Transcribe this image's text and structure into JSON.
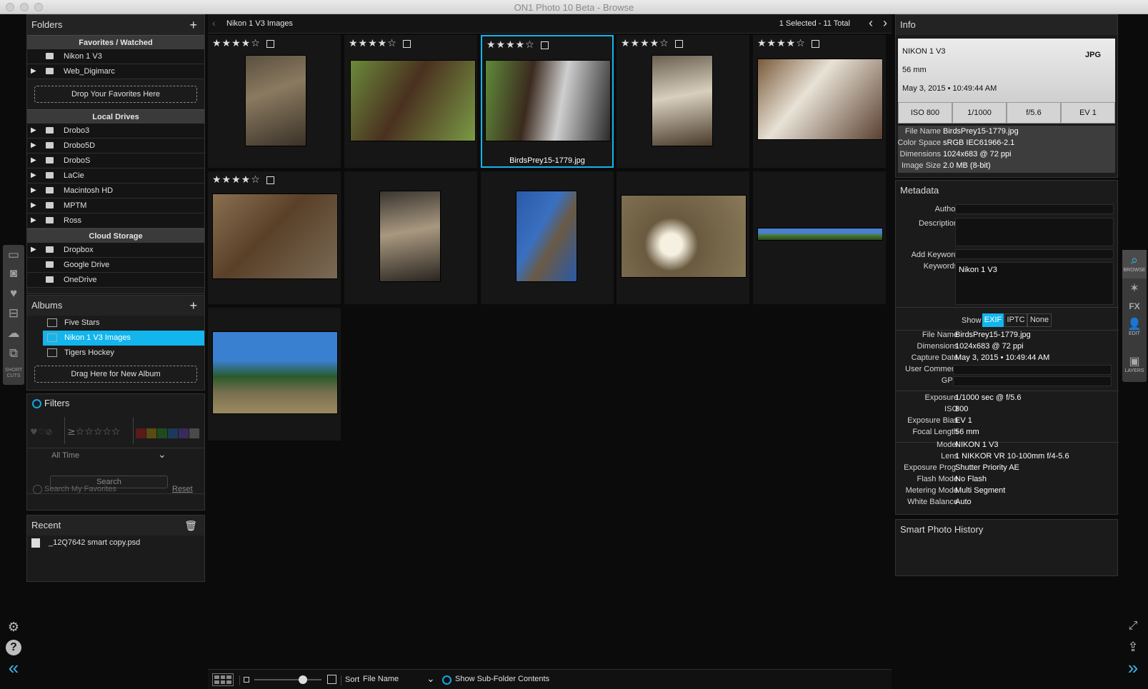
{
  "window": {
    "title": "ON1 Photo 10 Beta - Browse"
  },
  "folders": {
    "title": "Folders",
    "favorites_header": "Favorites / Watched",
    "favorites": [
      "Nikon 1 V3",
      "Web_Digimarc"
    ],
    "drop_favorites": "Drop Your Favorites Here",
    "local_header": "Local Drives",
    "local": [
      "Drobo3",
      "Drobo5D",
      "DroboS",
      "LaCie",
      "Macintosh HD",
      "MPTM",
      "Ross"
    ],
    "cloud_header": "Cloud Storage",
    "cloud": [
      "Dropbox",
      "Google Drive",
      "OneDrive"
    ]
  },
  "albums": {
    "title": "Albums",
    "items": [
      "Five Stars",
      "Nikon 1 V3 Images",
      "Tigers Hockey"
    ],
    "selected_index": 1,
    "drop": "Drag Here for New Album"
  },
  "filters": {
    "title": "Filters",
    "time": "All Time",
    "search_placeholder": "Search",
    "search_favorites": "Search My Favorites",
    "reset": "Reset",
    "swatch_colors": [
      "#5a1a1a",
      "#5a4a14",
      "#1f4a1f",
      "#1b3a5a",
      "#3a2a5a",
      "#4a4a4a"
    ]
  },
  "recent": {
    "title": "Recent",
    "items": [
      "_12Q7642 smart copy.psd"
    ]
  },
  "left_rail": {
    "shortcuts_label": "SHORT CUTS"
  },
  "grid": {
    "path": "Nikon 1 V3 Images",
    "count": "1 Selected - 11 Total",
    "selected_name": "BirdsPrey15-1779.jpg",
    "rating": 4,
    "sort_label": "Sort",
    "sort_value": "File Name",
    "subfolder": "Show Sub-Folder Contents",
    "thumb_size": 0.72
  },
  "info": {
    "title": "Info",
    "camera": "NIKON 1 V3",
    "focal": "56 mm",
    "date": "May 3, 2015 • 10:49:44 AM",
    "format": "JPG",
    "iso": "ISO 800",
    "shutter": "1/1000",
    "aperture": "f/5.6",
    "ev": "EV 1",
    "file_name_k": "File Name",
    "file_name_v": "BirdsPrey15-1779.jpg",
    "color_space_k": "Color Space",
    "color_space_v": "sRGB IEC61966-2.1",
    "dimensions_k": "Dimensions",
    "dimensions_v": "1024x683 @ 72 ppi",
    "image_size_k": "Image Size",
    "image_size_v": "2.0 MB (8-bit)"
  },
  "metadata": {
    "title": "Metadata",
    "author": "Author",
    "description": "Description",
    "add_keyword": "Add Keyword",
    "keywords": "Keywords",
    "keywords_value": "Nikon 1 V3",
    "show": "Show",
    "tabs": [
      "EXIF",
      "IPTC",
      "None"
    ],
    "exif": [
      [
        "File Name",
        "BirdsPrey15-1779.jpg"
      ],
      [
        "Dimensions",
        "1024x683 @ 72 ppi"
      ],
      [
        "Capture Date",
        "May 3, 2015 • 10:49:44 AM"
      ],
      [
        "User Comment",
        ""
      ],
      [
        "GPS",
        ""
      ],
      [
        "Exposure",
        "1/1000 sec @ f/5.6"
      ],
      [
        "ISO",
        "800"
      ],
      [
        "Exposure Bias",
        "EV 1"
      ],
      [
        "Focal Length",
        "56 mm"
      ],
      [
        "Model",
        "NIKON 1 V3"
      ],
      [
        "Lens",
        "1 NIKKOR VR 10-100mm f/4-5.6"
      ],
      [
        "Exposure Prog.",
        "Shutter Priority AE"
      ],
      [
        "Flash Mode",
        "No Flash"
      ],
      [
        "Metering Mode",
        "Multi Segment"
      ],
      [
        "White Balance",
        "Auto"
      ]
    ]
  },
  "history": {
    "title": "Smart Photo History"
  },
  "right_rail": {
    "browse": "BROWSE",
    "edit": "EDIT",
    "layers": "LAYERS"
  }
}
